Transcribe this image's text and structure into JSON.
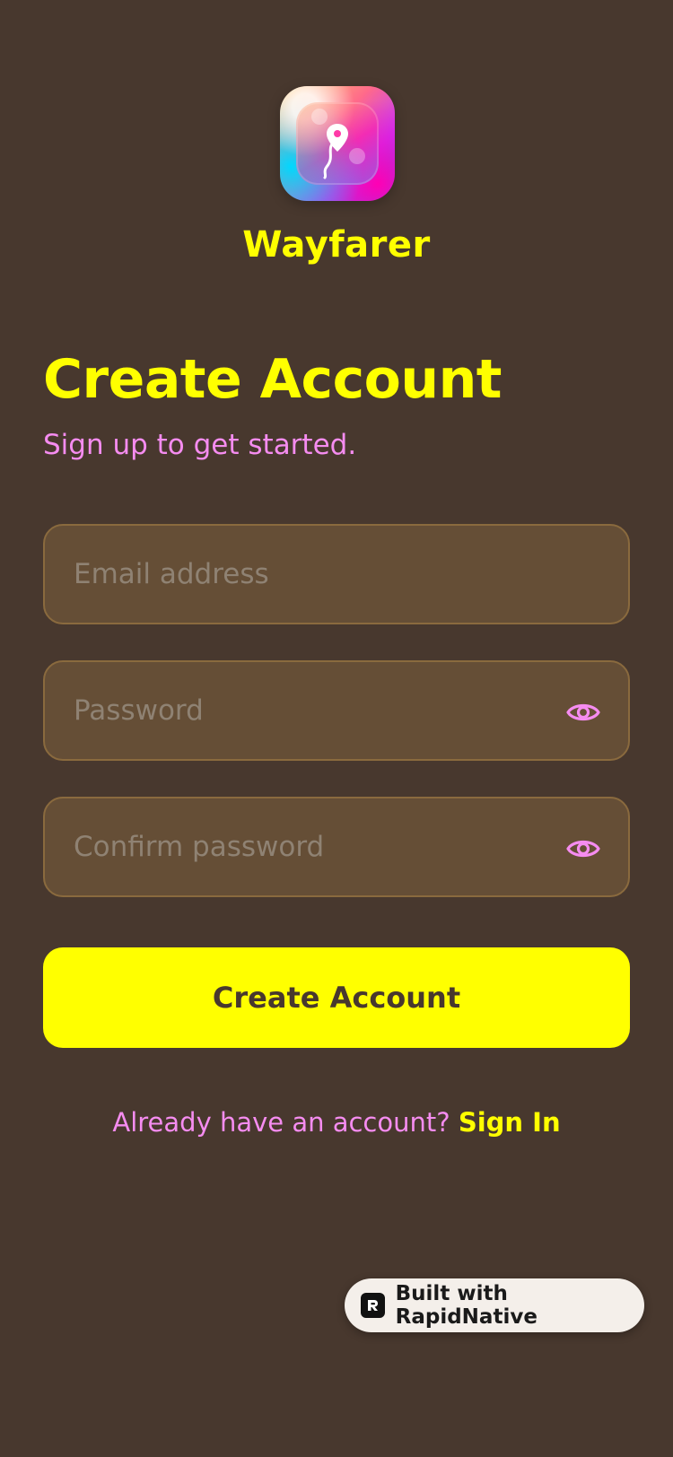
{
  "app": {
    "name": "Wayfarer"
  },
  "header": {
    "title": "Create Account",
    "subtitle": "Sign up to get started."
  },
  "form": {
    "email": {
      "value": "",
      "placeholder": "Email address"
    },
    "password": {
      "value": "",
      "placeholder": "Password",
      "toggle_icon": "eye-icon"
    },
    "confirm_password": {
      "value": "",
      "placeholder": "Confirm password",
      "toggle_icon": "eye-icon"
    },
    "submit_label": "Create Account"
  },
  "footer": {
    "prompt": "Already have an account?",
    "link_label": "Sign In"
  },
  "badge": {
    "label": "Built with RapidNative",
    "icon": "rapidnative-logo-icon"
  },
  "colors": {
    "background": "#48382e",
    "accent": "#ffff00",
    "secondary_text": "#f58cf0",
    "field_background": "#654e36",
    "field_border": "#8a6a3e"
  }
}
